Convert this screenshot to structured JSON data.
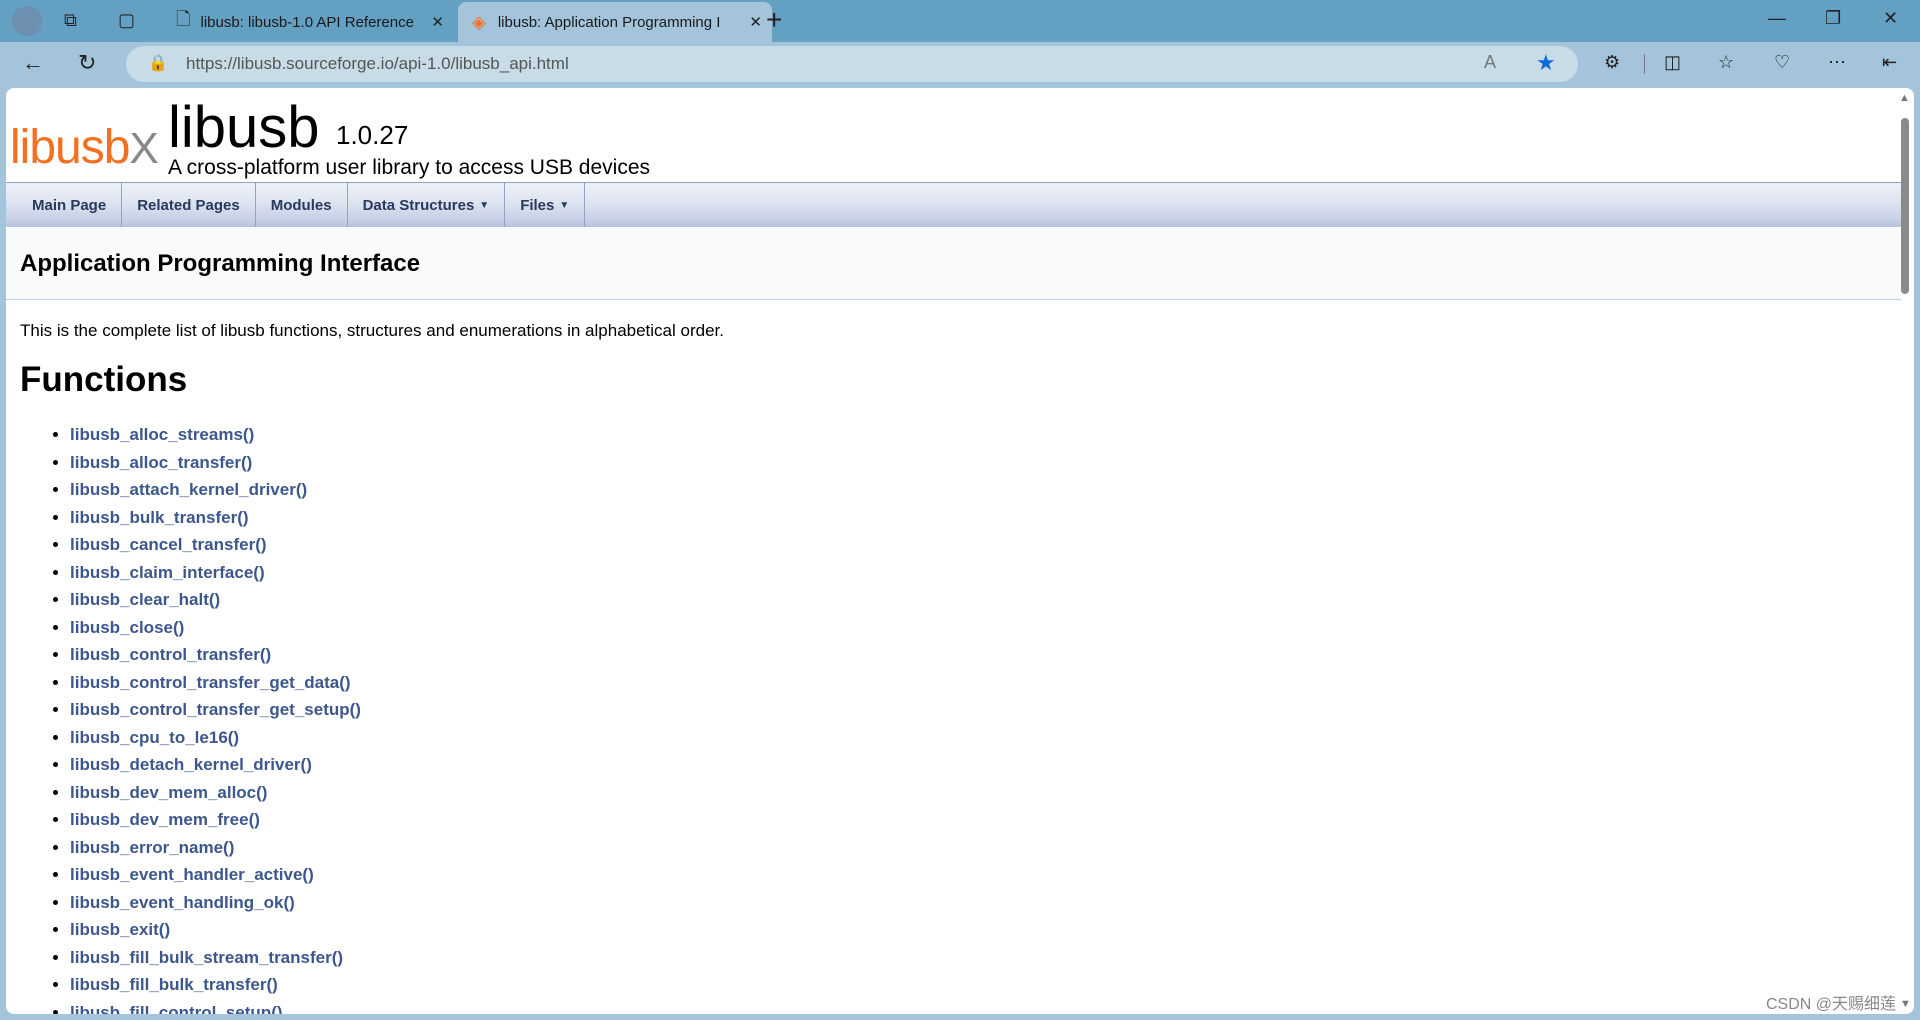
{
  "browser": {
    "tabs": [
      {
        "label": "libusb: libusb-1.0 API Reference",
        "icon": "document-icon",
        "active": false
      },
      {
        "label": "libusb: Application Programming Interface",
        "icon": "sourceforge-icon",
        "active": true
      }
    ],
    "new_tab": "+",
    "url": "https://libusb.sourceforge.io/api-1.0/libusb_api.html"
  },
  "page": {
    "logo": "libusbx",
    "project_name": "libusb",
    "project_number": "1.0.27",
    "project_brief": "A cross-platform user library to access USB devices",
    "nav": [
      {
        "label": "Main Page",
        "dropdown": false
      },
      {
        "label": "Related Pages",
        "dropdown": false
      },
      {
        "label": "Modules",
        "dropdown": false
      },
      {
        "label": "Data Structures",
        "dropdown": true
      },
      {
        "label": "Files",
        "dropdown": true
      }
    ],
    "title": "Application Programming Interface",
    "intro": "This is the complete list of libusb functions, structures and enumerations in alphabetical order.",
    "functions_heading": "Functions",
    "functions": [
      "libusb_alloc_streams()",
      "libusb_alloc_transfer()",
      "libusb_attach_kernel_driver()",
      "libusb_bulk_transfer()",
      "libusb_cancel_transfer()",
      "libusb_claim_interface()",
      "libusb_clear_halt()",
      "libusb_close()",
      "libusb_control_transfer()",
      "libusb_control_transfer_get_data()",
      "libusb_control_transfer_get_setup()",
      "libusb_cpu_to_le16()",
      "libusb_detach_kernel_driver()",
      "libusb_dev_mem_alloc()",
      "libusb_dev_mem_free()",
      "libusb_error_name()",
      "libusb_event_handler_active()",
      "libusb_event_handling_ok()",
      "libusb_exit()",
      "libusb_fill_bulk_stream_transfer()",
      "libusb_fill_bulk_transfer()",
      "libusb_fill_control_setup()"
    ],
    "link_color": "#3d578c"
  },
  "watermark": "CSDN @天赐细莲"
}
